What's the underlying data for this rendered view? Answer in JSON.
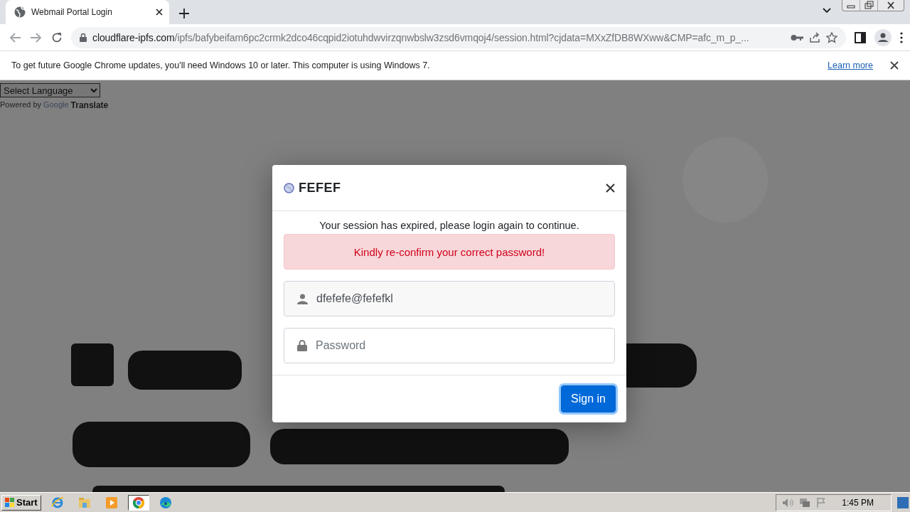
{
  "browser": {
    "tab": {
      "title": "Webmail Portal Login",
      "selected": true
    },
    "address": {
      "domain": "cloudflare-ipfs.com",
      "path": "/ipfs/bafybeifam6pc2crmk2dco46cqpid2iotuhdwvirzqnwbslw3zsd6vmqoj4/session.html?cjdata=MXxZfDB8WXww&CMP=afc_m_p_..."
    }
  },
  "infobar": {
    "message": "To get future Google Chrome updates, you'll need Windows 10 or later. This computer is using Windows 7.",
    "link": "Learn more"
  },
  "translate": {
    "select": "Select Language",
    "powered_by": "Powered by",
    "brand": "Google",
    "product": "Translate"
  },
  "modal": {
    "title": "FEFEF",
    "message": "Your session has expired, please login again to continue.",
    "alert": "Kindly re-confirm your correct password!",
    "fields": [
      {
        "kind": "user",
        "value": "dfefefe@fefefkl"
      },
      {
        "kind": "password",
        "placeholder": "Password"
      }
    ],
    "button": "Sign in"
  },
  "taskbar": {
    "start": "Start",
    "apps": [
      {
        "kind": "ie",
        "selected": false
      },
      {
        "kind": "explorer",
        "selected": false
      },
      {
        "kind": "media",
        "selected": false
      },
      {
        "kind": "chrome",
        "selected": true
      },
      {
        "kind": "edge",
        "selected": false
      }
    ],
    "clock": "1:45 PM"
  }
}
